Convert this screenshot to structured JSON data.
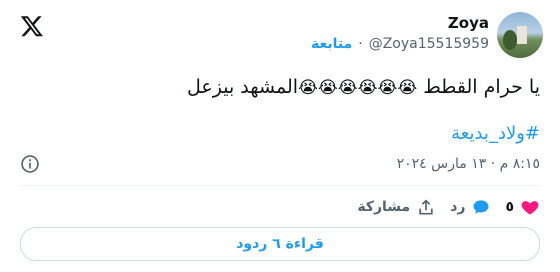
{
  "user": {
    "name": "Zoya",
    "handle": "@Zoya15515959",
    "follow_label": "متابعة",
    "separator": "·"
  },
  "tweet": {
    "text_start": "يا حرام القطط ",
    "emoji": "😭😭😭😭😭😭",
    "text_end": "المشهد بيزعل",
    "hashtag": "#ولاد_بديعة",
    "timestamp": "٨:١٥ م · ١٣ مارس ٢٠٢٤"
  },
  "actions": {
    "likes_count": "٥",
    "reply_label": "رد",
    "share_label": "مشاركة"
  },
  "read_replies_label": "قراءة ٦ ردود",
  "colors": {
    "accent": "#1d9bf0",
    "like": "#f91880",
    "muted": "#536471"
  }
}
